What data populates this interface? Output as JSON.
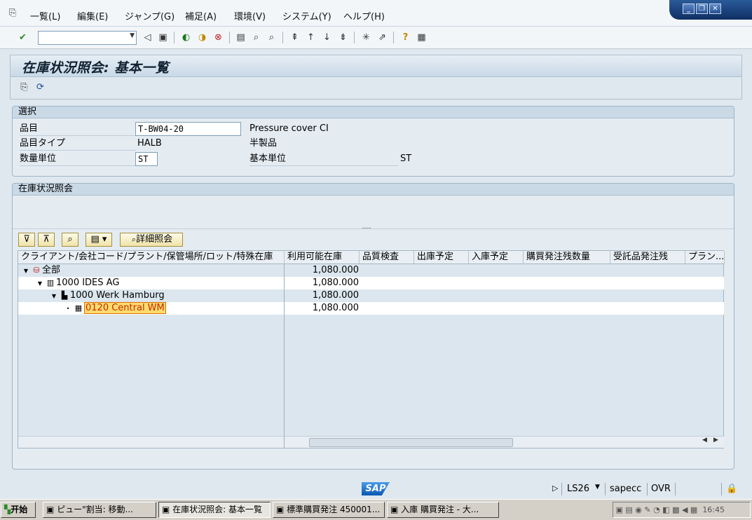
{
  "menu": [
    "一覧(L)",
    "編集(E)",
    "ジャンプ(G)",
    "補足(A)",
    "環境(V)",
    "システム(Y)",
    "ヘルプ(H)"
  ],
  "window_controls": [
    "_",
    "❐",
    "✕"
  ],
  "toolbar": {
    "command_field": ""
  },
  "title": "在庫状況照会: 基本一覧",
  "selection": {
    "header": "選択",
    "material_label": "品目",
    "material_value": "T-BW04-20",
    "material_desc": "Pressure cover CI",
    "material_type_label": "品目タイプ",
    "material_type_value": "HALB",
    "material_type_desc": "半製品",
    "unit_label": "数量単位",
    "unit_value": "ST",
    "base_unit_label": "基本単位",
    "base_unit_value": "ST"
  },
  "stock": {
    "header": "在庫状況照会",
    "detail_button": "詳細照会",
    "columns": [
      "クライアント/会社コード/プラント/保管場所/ロット/特殊在庫",
      "利用可能在庫",
      "品質検査",
      "出庫予定",
      "入庫予定",
      "購買発注残数量",
      "受託品発注残",
      "プラン..."
    ],
    "rows": [
      {
        "label": "全部",
        "qty": "1,080.000",
        "icon": "all-stock-icon"
      },
      {
        "label": "1000 IDES AG",
        "qty": "1,080.000",
        "icon": "company-icon"
      },
      {
        "label": "1000 Werk Hamburg",
        "qty": "1,080.000",
        "icon": "plant-icon"
      },
      {
        "label": "0120 Central WM",
        "qty": "1,080.000",
        "icon": "storage-location-icon"
      }
    ]
  },
  "status": {
    "system": "LS26",
    "server": "sapecc",
    "mode": "OVR"
  },
  "taskbar": {
    "start": "开始",
    "tasks": [
      "ピュー\"割当: 移動...",
      "在庫状況照会: 基本一覧",
      "標準購買発注 450001...",
      "入庫 購買発注 - 大..."
    ],
    "clock": "16:45"
  }
}
